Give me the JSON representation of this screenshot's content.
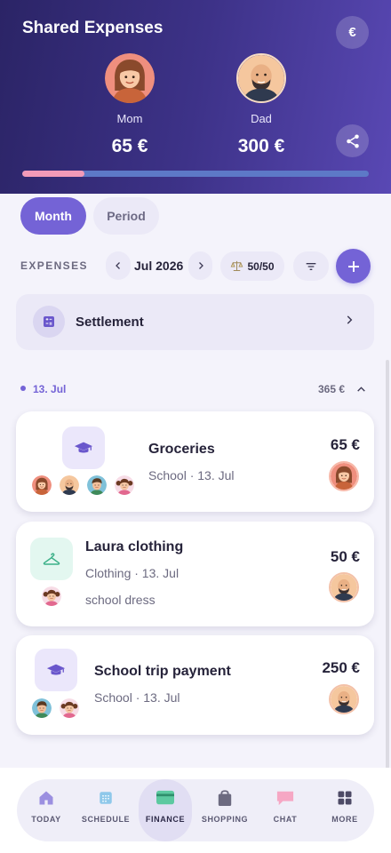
{
  "header": {
    "title": "Shared Expenses",
    "currency_symbol": "€",
    "mom": {
      "name": "Mom",
      "amount": "65 €"
    },
    "dad": {
      "name": "Dad",
      "amount": "300 €"
    },
    "balance_fraction": 0.18
  },
  "view_toggle": {
    "month": "Month",
    "period": "Period",
    "selected": "Month"
  },
  "toolbar": {
    "label": "EXPENSES",
    "period": "Jul 2026",
    "split": "50/50"
  },
  "settlement": {
    "label": "Settlement"
  },
  "group": {
    "date": "13. Jul",
    "total": "365 €"
  },
  "expenses": [
    {
      "title": "Groceries",
      "meta": "School · 13. Jul",
      "amount": "65 €",
      "category_icon": "graduation-cap-icon",
      "payer": "mom"
    },
    {
      "title": "Laura clothing",
      "meta": "Clothing · 13. Jul",
      "note": "school dress",
      "amount": "50 €",
      "category_icon": "hanger-icon",
      "payer": "dad"
    },
    {
      "title": "School trip payment",
      "meta": "School · 13. Jul",
      "amount": "250 €",
      "category_icon": "graduation-cap-icon",
      "payer": "dad"
    }
  ],
  "tabs": [
    {
      "label": "TODAY",
      "icon": "home-icon"
    },
    {
      "label": "SCHEDULE",
      "icon": "calendar-icon"
    },
    {
      "label": "FINANCE",
      "icon": "wallet-icon",
      "active": true
    },
    {
      "label": "SHOPPING",
      "icon": "shopping-bag-icon"
    },
    {
      "label": "CHAT",
      "icon": "chat-icon"
    },
    {
      "label": "MORE",
      "icon": "grid-icon"
    }
  ],
  "colors": {
    "accent": "#7463d6",
    "header_start": "#2b2466",
    "header_end": "#5948b4",
    "progress_mom": "#f29ab8",
    "progress_dad": "#5d79c7"
  }
}
